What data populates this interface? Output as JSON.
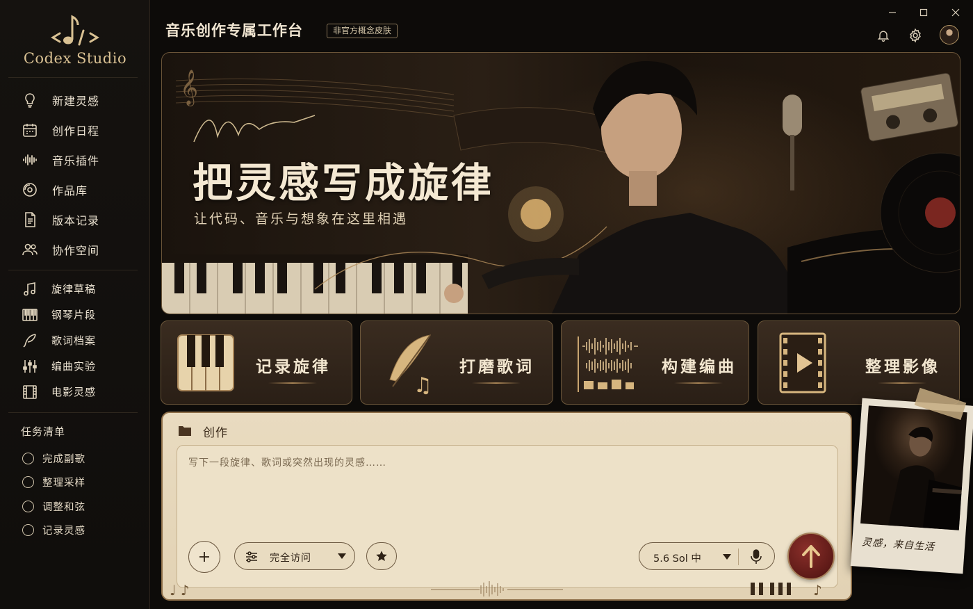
{
  "app": {
    "brand": "Codex Studio",
    "title": "音乐创作专属工作台",
    "badge": "非官方概念皮肤"
  },
  "window_controls": [
    "minimize-icon",
    "maximize-icon",
    "close-icon"
  ],
  "top_icons": [
    "bell-icon",
    "gear-icon",
    "avatar"
  ],
  "sidebar": {
    "main_items": [
      {
        "label": "新建灵感",
        "icon": "lightbulb-icon"
      },
      {
        "label": "创作日程",
        "icon": "calendar-icon"
      },
      {
        "label": "音乐插件",
        "icon": "waveform-icon"
      },
      {
        "label": "作品库",
        "icon": "disc-icon"
      },
      {
        "label": "版本记录",
        "icon": "document-icon"
      },
      {
        "label": "协作空间",
        "icon": "users-icon"
      }
    ],
    "secondary_items": [
      {
        "label": "旋律草稿",
        "icon": "music-note-icon"
      },
      {
        "label": "钢琴片段",
        "icon": "piano-icon"
      },
      {
        "label": "歌词档案",
        "icon": "quill-icon"
      },
      {
        "label": "编曲实验",
        "icon": "sliders-icon"
      },
      {
        "label": "电影灵感",
        "icon": "film-icon"
      }
    ],
    "tasks_title": "任务清单",
    "tasks": [
      "完成副歌",
      "整理采样",
      "调整和弦",
      "记录灵感"
    ]
  },
  "hero": {
    "title": "把灵感写成旋律",
    "subtitle": "让代码、音乐与想象在这里相遇"
  },
  "cards": [
    {
      "label": "记录旋律",
      "icon": "piano-keys-icon"
    },
    {
      "label": "打磨歌词",
      "icon": "feather-quill-icon"
    },
    {
      "label": "构建编曲",
      "icon": "arrangement-waveform-icon"
    },
    {
      "label": "整理影像",
      "icon": "film-play-icon"
    }
  ],
  "composer": {
    "header": "创作",
    "placeholder": "写下一段旋律、歌词或突然出现的灵感……",
    "access_label": "完全访问",
    "model_label": "5.6 Sol 中"
  },
  "polaroid": {
    "caption": "灵感，来自生活"
  },
  "colors": {
    "accent_gold": "#d9c193",
    "send_button": "#6e1f1b",
    "paper": "#e9dbc0"
  }
}
